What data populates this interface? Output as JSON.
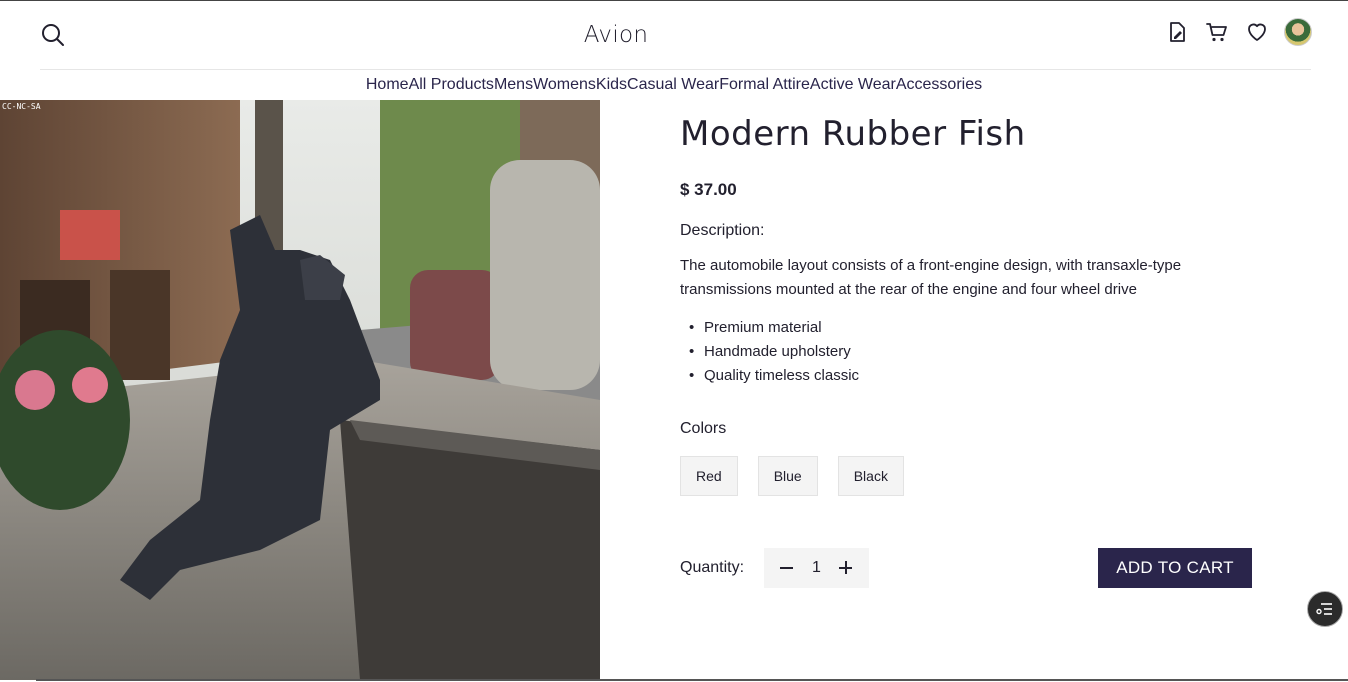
{
  "header": {
    "brand": "Avion",
    "icons": [
      "search-icon",
      "edit-document-icon",
      "cart-icon",
      "heart-icon",
      "avatar"
    ]
  },
  "nav": {
    "items": [
      {
        "label": "Home",
        "active": true
      },
      {
        "label": "All Products",
        "active": false
      },
      {
        "label": "Mens",
        "active": false
      },
      {
        "label": "Womens",
        "active": false
      },
      {
        "label": "Kids",
        "active": false
      },
      {
        "label": "Casual Wear",
        "active": false
      },
      {
        "label": "Formal Attire",
        "active": false
      },
      {
        "label": "Active Wear",
        "active": false
      },
      {
        "label": "Accessories",
        "active": false
      }
    ]
  },
  "product": {
    "image_watermark": "CC-NC-SA",
    "title": "Modern Rubber Fish",
    "price": "$ 37.00",
    "description_heading": "Description:",
    "description": "The automobile layout consists of a front-engine design, with transaxle-type transmissions mounted at the rear of the engine and four wheel drive",
    "features": [
      "Premium material",
      "Handmade upholstery",
      "Quality timeless classic"
    ],
    "colors_heading": "Colors",
    "colors": [
      "Red",
      "Blue",
      "Black"
    ],
    "quantity_label": "Quantity:",
    "quantity": "1",
    "add_to_cart": "ADD TO CART"
  },
  "colors": {
    "primary": "#2a254b",
    "text": "#22202e",
    "muted": "#726e8d",
    "chip_bg": "#f4f4f4"
  }
}
